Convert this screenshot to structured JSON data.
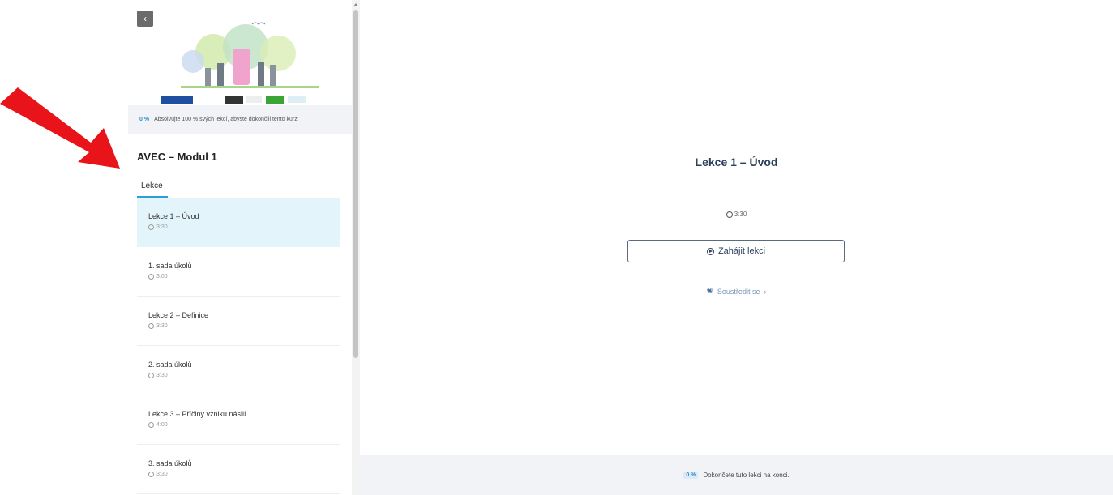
{
  "sidebar": {
    "back_icon": "chevron-left-icon",
    "progress": {
      "percent": "0 %",
      "text": "Absolvujte 100 % svých lekcí, abyste dokončili tento kurz"
    },
    "module_title": "AVEC – Modul 1",
    "tab_label": "Lekce",
    "lessons": [
      {
        "title": "Lekce 1 – Úvod",
        "duration": "3:30",
        "active": true
      },
      {
        "title": "1. sada úkolů",
        "duration": "3:00"
      },
      {
        "title": "Lekce 2 – Definice",
        "duration": "3:30"
      },
      {
        "title": "2. sada úkolů",
        "duration": "3:30"
      },
      {
        "title": "Lekce 3 – Příčiny vzniku násilí",
        "duration": "4:00"
      },
      {
        "title": "3. sada úkolů",
        "duration": "3:30"
      }
    ]
  },
  "main": {
    "lesson_title": "Lekce 1 – Úvod",
    "duration": "3:30",
    "start_button": "Zahájit lekci",
    "focus_link": "Soustředit se",
    "footer": {
      "percent": "0 %",
      "text": "Dokončete tuto lekci na konci."
    }
  },
  "colors": {
    "accent": "#2b9fd6",
    "active_bg": "#e3f4fb",
    "heading": "#2c3e5c",
    "arrow": "#e8141a"
  }
}
